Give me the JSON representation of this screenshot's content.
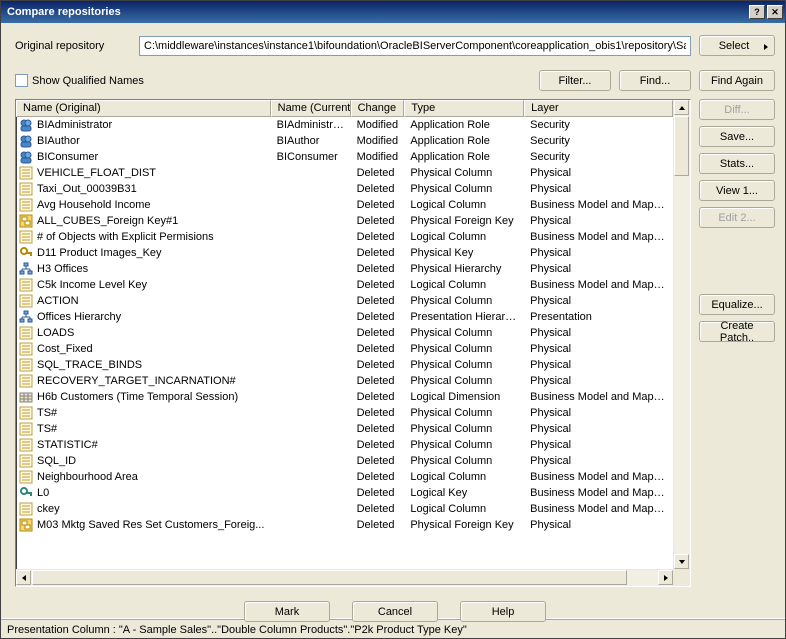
{
  "title": "Compare repositories",
  "repo": {
    "label": "Original repository",
    "path": "C:\\middleware\\instances\\instance1\\bifoundation\\OracleBIServerComponent\\coreapplication_obis1\\repository\\Sa"
  },
  "show_qualified_label": "Show Qualified Names",
  "buttons": {
    "select": "Select",
    "filter": "Filter...",
    "find": "Find...",
    "find_again": "Find Again",
    "diff": "Diff...",
    "save": "Save...",
    "stats": "Stats...",
    "view1": "View 1...",
    "edit2": "Edit 2...",
    "equalize": "Equalize...",
    "create_patch": "Create Patch..",
    "mark": "Mark",
    "cancel": "Cancel",
    "help": "Help"
  },
  "columns": {
    "name_original": "Name (Original)",
    "name_current": "Name (Current)",
    "change": "Change",
    "type": "Type",
    "layer": "Layer"
  },
  "rows": [
    {
      "icon": "role",
      "name": "BIAdministrator",
      "current": "BIAdministrator",
      "change": "Modified",
      "type": "Application Role",
      "layer": "Security"
    },
    {
      "icon": "role",
      "name": "BIAuthor",
      "current": "BIAuthor",
      "change": "Modified",
      "type": "Application Role",
      "layer": "Security"
    },
    {
      "icon": "role",
      "name": "BIConsumer",
      "current": "BIConsumer",
      "change": "Modified",
      "type": "Application Role",
      "layer": "Security"
    },
    {
      "icon": "col",
      "name": "VEHICLE_FLOAT_DIST",
      "current": "",
      "change": "Deleted",
      "type": "Physical Column",
      "layer": "Physical"
    },
    {
      "icon": "col",
      "name": "Taxi_Out_00039B31",
      "current": "",
      "change": "Deleted",
      "type": "Physical Column",
      "layer": "Physical"
    },
    {
      "icon": "col",
      "name": "Avg Household Income",
      "current": "",
      "change": "Deleted",
      "type": "Logical Column",
      "layer": "Business Model and Mapping"
    },
    {
      "icon": "fk",
      "name": "ALL_CUBES_Foreign Key#1",
      "current": "",
      "change": "Deleted",
      "type": "Physical Foreign Key",
      "layer": "Physical"
    },
    {
      "icon": "col",
      "name": "# of Objects with Explicit Permisions",
      "current": "",
      "change": "Deleted",
      "type": "Logical Column",
      "layer": "Business Model and Mapping"
    },
    {
      "icon": "key",
      "name": "D11 Product Images_Key",
      "current": "",
      "change": "Deleted",
      "type": "Physical Key",
      "layer": "Physical"
    },
    {
      "icon": "hier",
      "name": "H3 Offices",
      "current": "",
      "change": "Deleted",
      "type": "Physical Hierarchy",
      "layer": "Physical"
    },
    {
      "icon": "col",
      "name": "C5k  Income Level Key",
      "current": "",
      "change": "Deleted",
      "type": "Logical Column",
      "layer": "Business Model and Mapping"
    },
    {
      "icon": "col",
      "name": "ACTION",
      "current": "",
      "change": "Deleted",
      "type": "Physical Column",
      "layer": "Physical"
    },
    {
      "icon": "hier",
      "name": "Offices Hierarchy",
      "current": "",
      "change": "Deleted",
      "type": "Presentation Hierarchy",
      "layer": "Presentation"
    },
    {
      "icon": "col",
      "name": "LOADS",
      "current": "",
      "change": "Deleted",
      "type": "Physical Column",
      "layer": "Physical"
    },
    {
      "icon": "col",
      "name": "Cost_Fixed",
      "current": "",
      "change": "Deleted",
      "type": "Physical Column",
      "layer": "Physical"
    },
    {
      "icon": "col",
      "name": "SQL_TRACE_BINDS",
      "current": "",
      "change": "Deleted",
      "type": "Physical Column",
      "layer": "Physical"
    },
    {
      "icon": "col",
      "name": "RECOVERY_TARGET_INCARNATION#",
      "current": "",
      "change": "Deleted",
      "type": "Physical Column",
      "layer": "Physical"
    },
    {
      "icon": "dim",
      "name": "H6b Customers (Time Temporal Session)",
      "current": "",
      "change": "Deleted",
      "type": "Logical Dimension",
      "layer": "Business Model and Mapping"
    },
    {
      "icon": "col",
      "name": "TS#",
      "current": "",
      "change": "Deleted",
      "type": "Physical Column",
      "layer": "Physical"
    },
    {
      "icon": "col",
      "name": "TS#",
      "current": "",
      "change": "Deleted",
      "type": "Physical Column",
      "layer": "Physical"
    },
    {
      "icon": "col",
      "name": "STATISTIC#",
      "current": "",
      "change": "Deleted",
      "type": "Physical Column",
      "layer": "Physical"
    },
    {
      "icon": "col",
      "name": "SQL_ID",
      "current": "",
      "change": "Deleted",
      "type": "Physical Column",
      "layer": "Physical"
    },
    {
      "icon": "col",
      "name": "Neighbourhood Area",
      "current": "",
      "change": "Deleted",
      "type": "Logical Column",
      "layer": "Business Model and Mapping"
    },
    {
      "icon": "lkey",
      "name": "L0",
      "current": "",
      "change": "Deleted",
      "type": "Logical Key",
      "layer": "Business Model and Mapping"
    },
    {
      "icon": "col",
      "name": "ckey",
      "current": "",
      "change": "Deleted",
      "type": "Logical Column",
      "layer": "Business Model and Mapping"
    },
    {
      "icon": "fk",
      "name": "M03 Mktg Saved Res Set Customers_Foreig...",
      "current": "",
      "change": "Deleted",
      "type": "Physical Foreign Key",
      "layer": "Physical"
    }
  ],
  "statusbar": "Presentation Column : \"A - Sample Sales\"..\"Double Column Products\".\"P2k  Product Type Key\""
}
